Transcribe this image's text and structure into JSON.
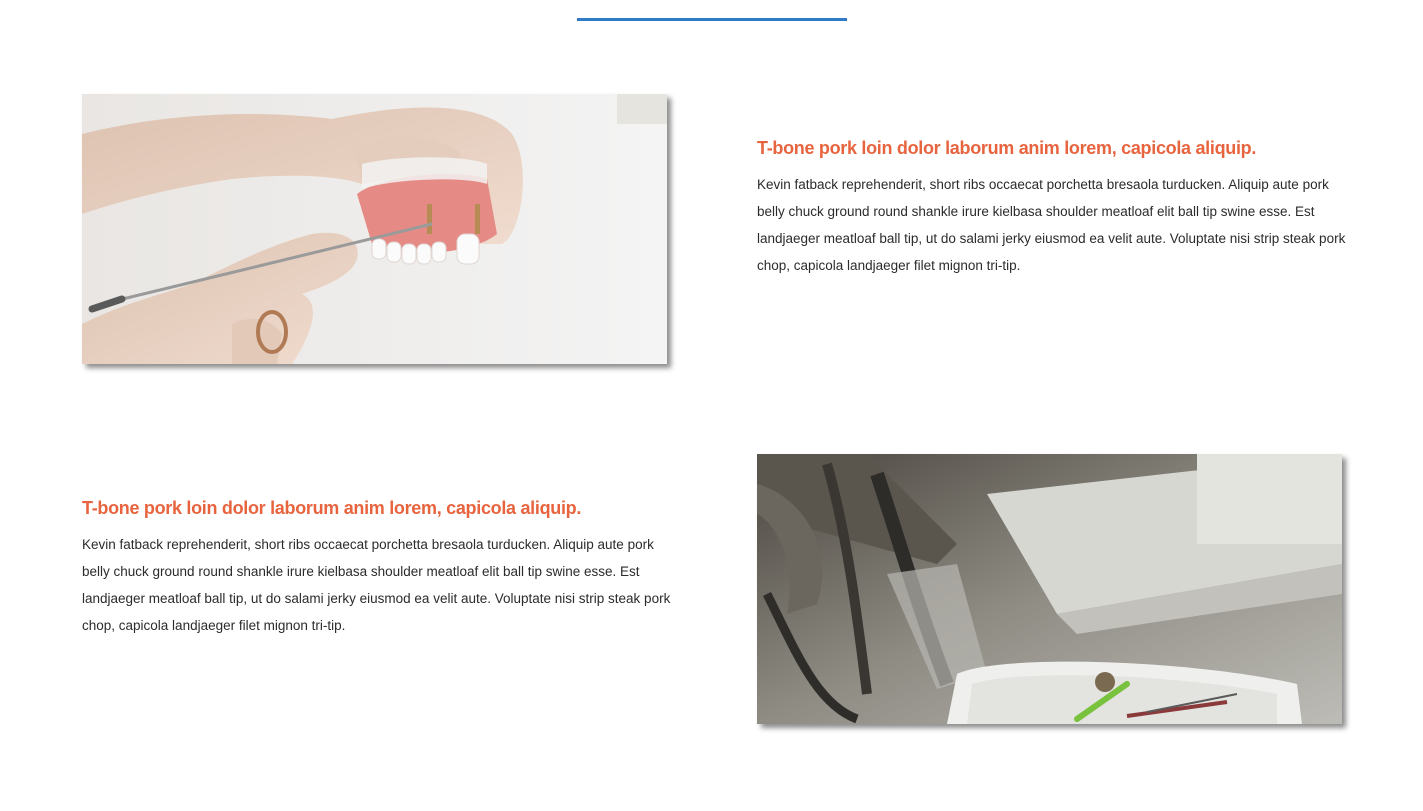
{
  "colors": {
    "accent_rule": "#2f7bc7",
    "heading": "#e8643f",
    "body_text": "#2b2b2b"
  },
  "features": [
    {
      "image_subject": "hands-holding-denture-model-with-dental-probe",
      "heading": "T-bone pork loin dolor laborum anim lorem, capicola aliquip.",
      "body": "Kevin fatback reprehenderit, short ribs occaecat porchetta bresaola turducken. Aliquip aute pork belly chuck ground round shankle irure kielbasa shoulder meatloaf elit ball tip swine esse. Est landjaeger meatloaf ball tip, ut do salami jerky eiusmod ea velit aute. Voluptate nisi strip steak pork chop, capicola landjaeger filet mignon tri-tip."
    },
    {
      "image_subject": "dental-chair-instrument-tray",
      "heading": "T-bone pork loin dolor laborum anim lorem, capicola aliquip.",
      "body": "Kevin fatback reprehenderit, short ribs occaecat porchetta bresaola turducken. Aliquip aute pork belly chuck ground round shankle irure kielbasa shoulder meatloaf elit ball tip swine esse. Est landjaeger meatloaf ball tip, ut do salami jerky eiusmod ea velit aute. Voluptate nisi strip steak pork chop, capicola landjaeger filet mignon tri-tip."
    }
  ]
}
